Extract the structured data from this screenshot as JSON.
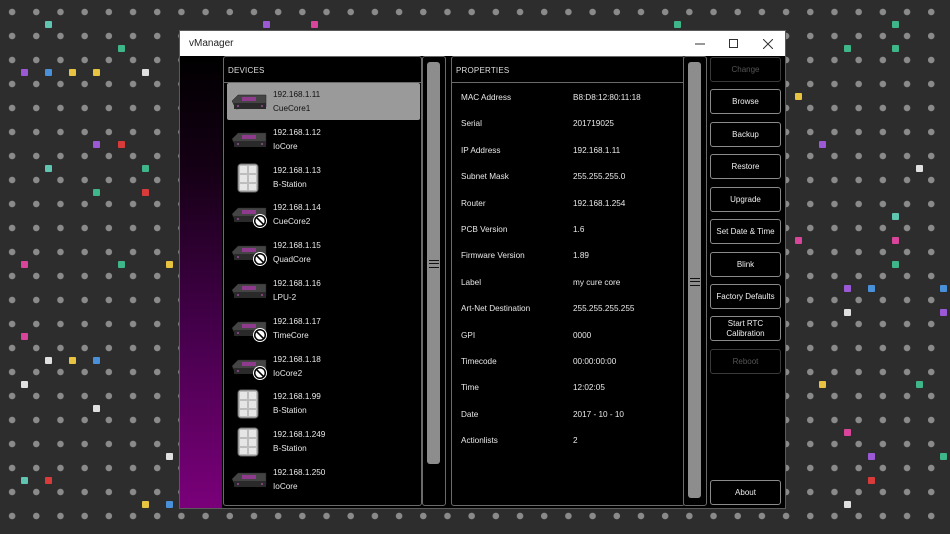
{
  "window": {
    "title": "vManager",
    "minimize_icon": "minimize-icon",
    "maximize_icon": "maximize-icon",
    "close_icon": "close-icon"
  },
  "devices": {
    "header": "DEVICES",
    "items": [
      {
        "ip": "192.168.1.11",
        "name": "CueCore1",
        "icon": "cuecore-device-icon",
        "offline": false,
        "selected": true
      },
      {
        "ip": "192.168.1.12",
        "name": "IoCore",
        "icon": "iocore-device-icon",
        "offline": false,
        "selected": false
      },
      {
        "ip": "192.168.1.13",
        "name": "B-Station",
        "icon": "bstation-device-icon",
        "offline": false,
        "selected": false
      },
      {
        "ip": "192.168.1.14",
        "name": "CueCore2",
        "icon": "cuecore-device-icon",
        "offline": true,
        "selected": false
      },
      {
        "ip": "192.168.1.15",
        "name": "QuadCore",
        "icon": "quadcore-device-icon",
        "offline": true,
        "selected": false
      },
      {
        "ip": "192.168.1.16",
        "name": "LPU-2",
        "icon": "lpu-device-icon",
        "offline": false,
        "selected": false
      },
      {
        "ip": "192.168.1.17",
        "name": "TimeCore",
        "icon": "timecore-device-icon",
        "offline": true,
        "selected": false
      },
      {
        "ip": "192.168.1.18",
        "name": "IoCore2",
        "icon": "iocore-device-icon",
        "offline": true,
        "selected": false
      },
      {
        "ip": "192.168.1.99",
        "name": "B-Station",
        "icon": "bstation-device-icon",
        "offline": false,
        "selected": false
      },
      {
        "ip": "192.168.1.249",
        "name": "B-Station",
        "icon": "bstation-device-icon",
        "offline": false,
        "selected": false
      },
      {
        "ip": "192.168.1.250",
        "name": "IoCore",
        "icon": "iocore-device-icon",
        "offline": false,
        "selected": false
      }
    ]
  },
  "properties": {
    "header": "PROPERTIES",
    "rows": [
      {
        "key": "MAC Address",
        "value": "B8:D8:12:80:11:18"
      },
      {
        "key": "Serial",
        "value": "201719025"
      },
      {
        "key": "IP Address",
        "value": "192.168.1.11"
      },
      {
        "key": "Subnet Mask",
        "value": "255.255.255.0"
      },
      {
        "key": "Router",
        "value": "192.168.1.254"
      },
      {
        "key": "PCB Version",
        "value": "1.6"
      },
      {
        "key": "Firmware Version",
        "value": "1.89"
      },
      {
        "key": "Label",
        "value": "my cure core"
      },
      {
        "key": "Art-Net Destination",
        "value": "255.255.255.255"
      },
      {
        "key": "GPI",
        "value": "0000"
      },
      {
        "key": "Timecode",
        "value": "00:00:00:00"
      },
      {
        "key": "Time",
        "value": "12:02:05"
      },
      {
        "key": "Date",
        "value": "2017 - 10 - 10"
      },
      {
        "key": "Actionlists",
        "value": "2"
      }
    ]
  },
  "actions": {
    "change": "Change",
    "browse": "Browse",
    "backup": "Backup",
    "restore": "Restore",
    "upgrade": "Upgrade",
    "set_date_time": "Set Date & Time",
    "blink": "Blink",
    "factory_defaults": "Factory Defaults",
    "start_rtc_calibration_line1": "Start RTC",
    "start_rtc_calibration_line2": "Calibration",
    "reboot": "Reboot",
    "about": "About"
  },
  "colors": {
    "accent_purple": "#7a007a",
    "selected_row": "#9a9a9a",
    "dot_gray": "#8a8a8a"
  }
}
